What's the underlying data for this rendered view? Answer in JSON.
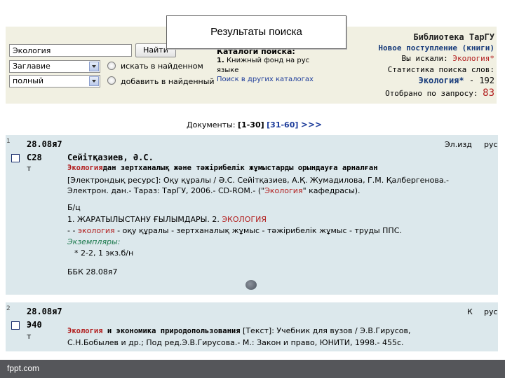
{
  "title_banner": "Результаты  поиска",
  "search": {
    "query_value": "Экология",
    "find_button": "Найти",
    "field_select": "Заглавие",
    "mode_select": "полный",
    "radio_search_found": "искать в найденном",
    "radio_add_found": "добавить в найденный"
  },
  "catalogs": {
    "heading": "Каталоги поиска:",
    "item_num": "1.",
    "item_text_l1": "Книжный фонд на рус",
    "item_text_l2": "языке",
    "other_link": "Поиск в других каталогах"
  },
  "library": {
    "name": "Библиотека ТарГУ",
    "new_arrivals": "Новое поступление (книги)",
    "searched_label": "Вы искали:",
    "searched_value": "Экология*",
    "stats_label": "Статистика поиска слов:",
    "stat_term": "Экология*",
    "stat_count": "- 192",
    "selected_label": "Отобрано по запросу:",
    "selected_count": "83"
  },
  "pagination": {
    "label": "Документы:",
    "current": "[1-30]",
    "next": "[31-60]",
    "more": ">>>"
  },
  "records": [
    {
      "num": "1",
      "bbk_code": "28.08я7",
      "type": "Эл.изд",
      "lang": "рус",
      "shelf_code": "С28",
      "shelf_sub": "т",
      "author": "Сейітқазиев, Ә.С.",
      "title_highlight": "Экология",
      "title_rest": "дан зертханалық және тәжірибелік жұмыстарды орындауға арналған",
      "desc_l1": "[Электрондық ресурс]: Оқу құралы / Ә.С. Сейітқазиев, А.Қ. Жумадилова, Г.М. Қалбергенова.-",
      "desc_l2_a": "Электрон. дан.- Тараз: ТарГУ, 2006.- CD-ROM.- (\"",
      "desc_l2_hl": "Экология",
      "desc_l2_b": "\" кафедрасы).",
      "bc": "Б/ц",
      "subject_a": "1. ЖАРАТЫЛЫСТАНУ ҒЫЛЫМДАРЫ. 2. ",
      "subject_hl": "ЭКОЛОГИЯ",
      "keywords_a": "- - ",
      "keywords_hl": "экология",
      "keywords_b": " - оқу құралы - зертханалық жұмыс - тәжірибелік жұмыс - труды ППС.",
      "copies_label": "Экземпляры:",
      "copies_value": "* 2-2, 1 экз.б/н",
      "bbk_line": "ББК 28.08я7"
    },
    {
      "num": "2",
      "bbk_code": "28.08я7",
      "type": "К",
      "lang": "рус",
      "shelf_code": "Э40",
      "shelf_sub": "т",
      "title_highlight": "Экология",
      "title_rest": " и экономика природопользования",
      "desc_l1": "[Текст]: Учебник для вузов / Э.В.Гирусов,",
      "desc_l2": "С.Н.Бобылев и др.; Под ред.Э.В.Гирусова.- М.: Закон и право, ЮНИТИ, 1998.- 455с."
    }
  ],
  "footer": "fppt.com",
  "colors": {
    "band": "#f1f0e2",
    "record_bg": "#dce8ec",
    "highlight": "#b21e1e",
    "footer_bg": "#55565a"
  }
}
